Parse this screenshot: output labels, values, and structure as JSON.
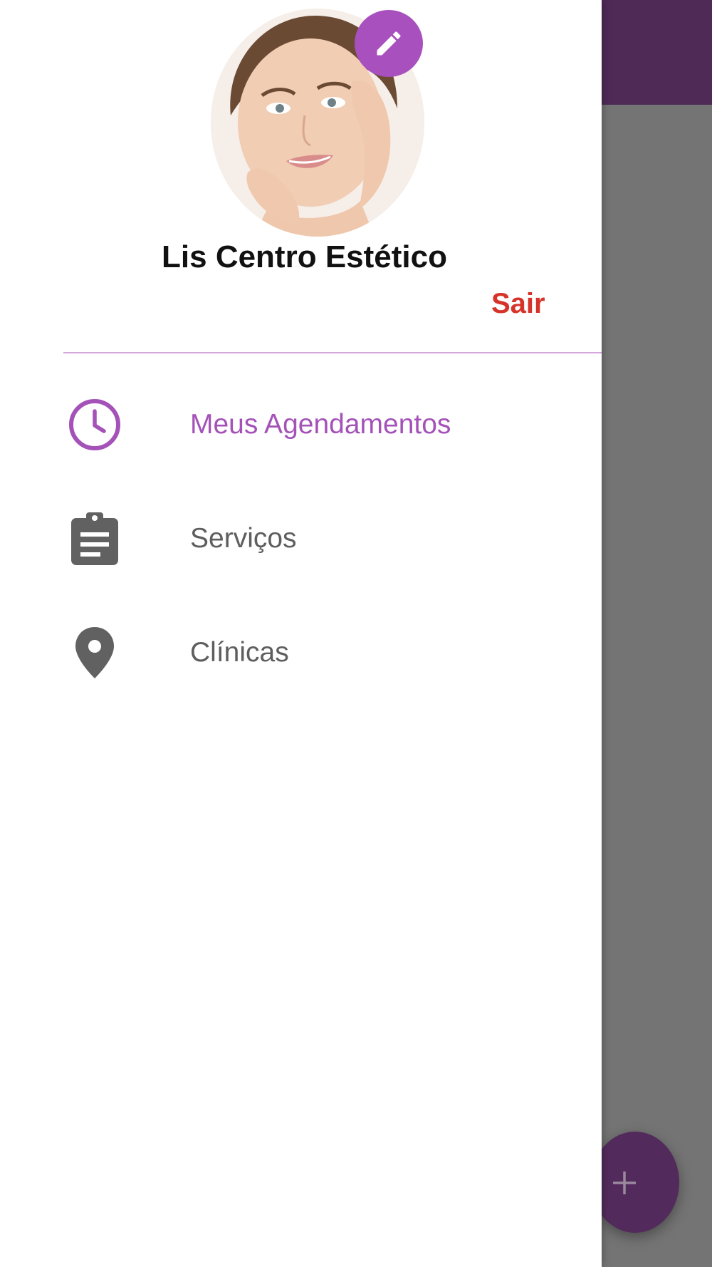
{
  "profile": {
    "name": "Lis Centro Estético",
    "logout_label": "Sair"
  },
  "menu": {
    "items": [
      {
        "label": "Meus Agendamentos",
        "icon": "clock-icon",
        "active": true
      },
      {
        "label": "Serviços",
        "icon": "clipboard-icon",
        "active": false
      },
      {
        "label": "Clínicas",
        "icon": "location-pin-icon",
        "active": false
      }
    ]
  },
  "colors": {
    "accent": "#a452b8",
    "logout": "#d6332a",
    "appbar": "#4f2a57",
    "fab": "#532a5c",
    "icon_default": "#616161"
  }
}
